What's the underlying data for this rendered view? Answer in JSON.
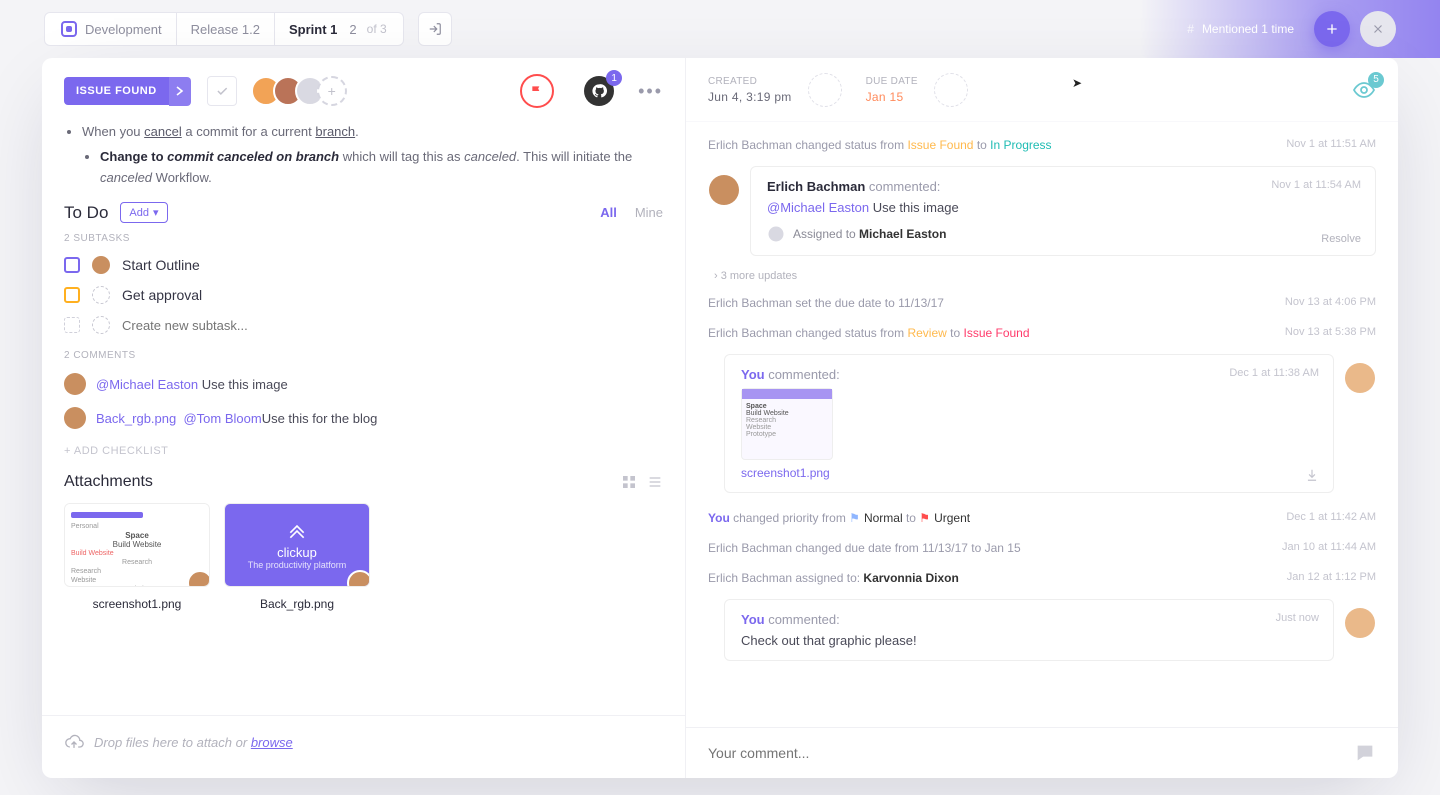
{
  "breadcrumb": {
    "space": "Development",
    "release": "Release 1.2",
    "sprint": "Sprint 1",
    "page": "2",
    "page_of": "of 3"
  },
  "mention_pill": "Mentioned 1 time",
  "status": {
    "label": "ISSUE FOUND"
  },
  "github_badge": "1",
  "meta": {
    "created_label": "CREATED",
    "created_value": "Jun 4, 3:19 pm",
    "due_label": "DUE DATE",
    "due_value": "Jan 15",
    "watch_badge": "5"
  },
  "desc": {
    "b1_pre": "When you ",
    "b1_cancel": "cancel",
    "b1_mid": " a commit for a current ",
    "b1_branch": "branch",
    "b1_end": ".",
    "b2_pre": "Change to ",
    "b2_em": "commit canceled on branch",
    "b2_mid": " which will tag this as ",
    "b2_em2": "canceled",
    "b2_mid2": ". This will initiate the ",
    "b2_em3": "canceled",
    "b2_end": " Workflow."
  },
  "todo": {
    "title": "To Do",
    "add": "Add",
    "filter_all": "All",
    "filter_mine": "Mine",
    "subtasks_label": "2 SUBTASKS",
    "items": [
      {
        "label": "Start Outline"
      },
      {
        "label": "Get approval"
      }
    ],
    "new_placeholder": "Create new subtask..."
  },
  "comments_label": "2 COMMENTS",
  "comments": {
    "c1_mention": "@Michael Easton",
    "c1_text": " Use this image",
    "c2_file": "Back_rgb.png",
    "c2_mention": "@Tom Bloom",
    "c2_text": "Use this for the blog"
  },
  "add_checklist": "+ ADD CHECKLIST",
  "attachments": {
    "title": "Attachments",
    "items": [
      {
        "name": "screenshot1.png"
      },
      {
        "name": "Back_rgb.png"
      }
    ],
    "clickup_label": "clickup",
    "clickup_tag": "The productivity platform"
  },
  "dropzone": {
    "text": "Drop files here to attach or ",
    "browse": "browse"
  },
  "activity": {
    "a1_pre": "Erlich Bachman changed status from ",
    "a1_from": "Issue Found",
    "a1_to_word": " to ",
    "a1_to": "In Progress",
    "a1_ts": "Nov 1 at 11:51 AM",
    "cb_name": "Erlich Bachman",
    "cb_action": " commented:",
    "cb_ts": "Nov 1 at 11:54 AM",
    "cb_mention": "@Michael Easton",
    "cb_text": " Use this image",
    "cb_assign_pre": "Assigned to ",
    "cb_assign_name": "Michael Easton",
    "cb_resolve": "Resolve",
    "more": "› 3 more updates",
    "a2_text": "Erlich Bachman set the due date to 11/13/17",
    "a2_ts": "Nov 13 at 4:06 PM",
    "a3_pre": "Erlich Bachman changed status from ",
    "a3_from": "Review",
    "a3_to_word": " to ",
    "a3_to": "Issue Found",
    "a3_ts": "Nov 13 at 5:38 PM",
    "you": "You",
    "yc_action": " commented:",
    "yc_ts": "Dec 1 at 11:38 AM",
    "yc_file": "screenshot1.png",
    "a4_pre": " changed priority from ",
    "a4_from": "Normal",
    "a4_to_word": " to ",
    "a4_to": "Urgent",
    "a4_ts": "Dec 1 at 11:42 AM",
    "a5_text": "Erlich Bachman changed due date from 11/13/17 to Jan 15",
    "a5_ts": "Jan 10 at 11:44 AM",
    "a6_pre": "Erlich Bachman assigned to: ",
    "a6_name": "Karvonnia Dixon",
    "a6_ts": "Jan 12 at 1:12 PM",
    "yc2_action": " commented:",
    "yc2_ts": "Just now",
    "yc2_body": "Check out that graphic please!"
  },
  "comment_input_placeholder": "Your comment..."
}
